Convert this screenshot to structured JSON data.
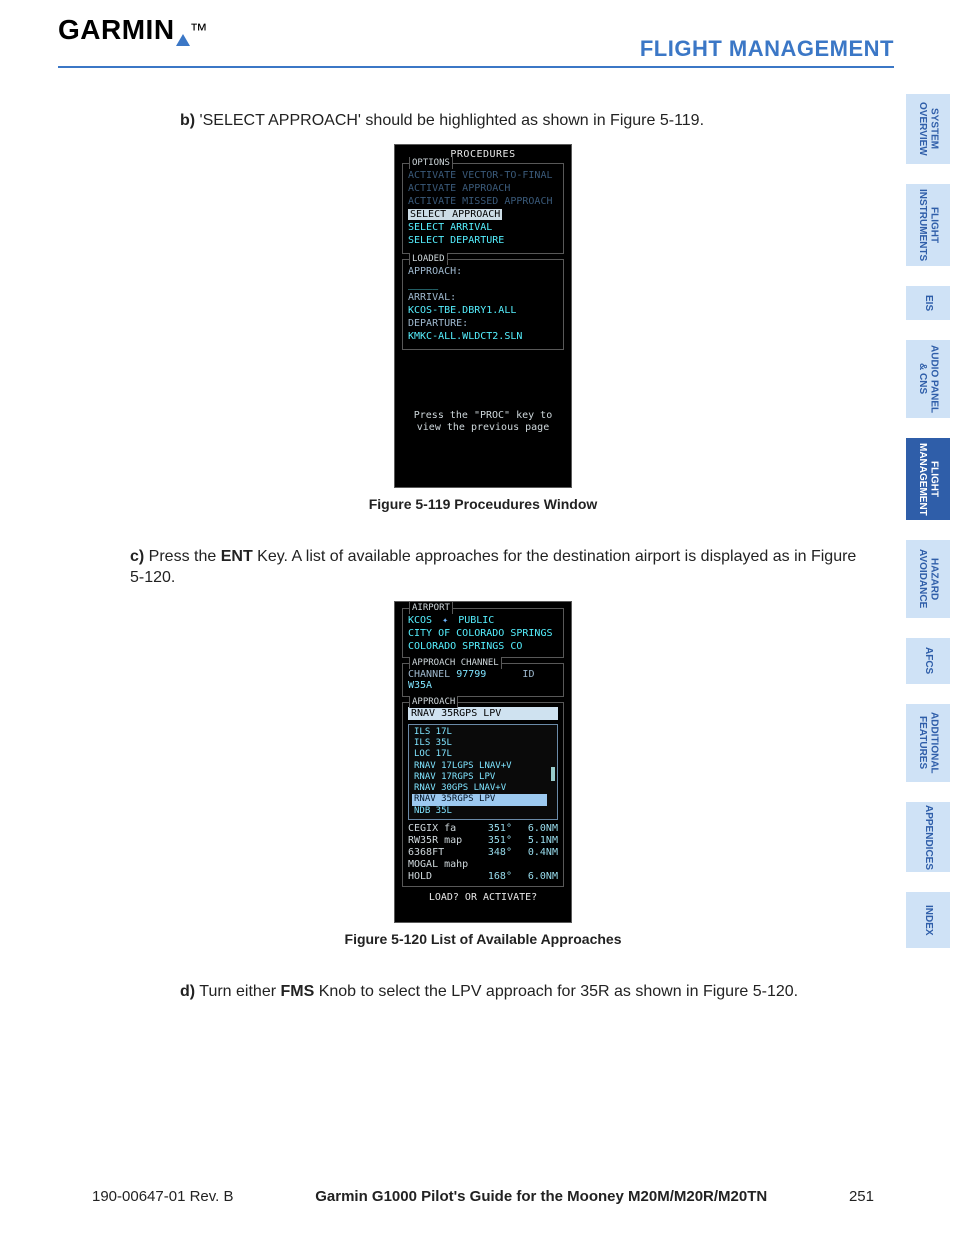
{
  "brand": "GARMIN",
  "header_section": "FLIGHT MANAGEMENT",
  "tabs": [
    "SYSTEM\nOVERVIEW",
    "FLIGHT\nINSTRUMENTS",
    "EIS",
    "AUDIO PANEL\n& CNS",
    "FLIGHT\nMANAGEMENT",
    "HAZARD\nAVOIDANCE",
    "AFCS",
    "ADDITIONAL\nFEATURES",
    "APPENDICES",
    "INDEX"
  ],
  "active_tab_index": 4,
  "para_b": {
    "label": "b)",
    "text": " 'SELECT APPROACH' should be highlighted as shown in Figure 5-119."
  },
  "fig119": {
    "title": "PROCEDURES",
    "options_tag": "OPTIONS",
    "opts": {
      "vtf": "ACTIVATE VECTOR-TO-FINAL",
      "act": "ACTIVATE APPROACH",
      "miss": "ACTIVATE MISSED APPROACH",
      "sel_appr": "SELECT APPROACH",
      "sel_arr": "SELECT ARRIVAL",
      "sel_dep": "SELECT DEPARTURE"
    },
    "loaded_tag": "LOADED",
    "appr_lbl": "APPROACH:",
    "appr_val": "_____",
    "arr_lbl": "ARRIVAL:",
    "arr_val": "KCOS-TBE.DBRY1.ALL",
    "dep_lbl": "DEPARTURE:",
    "dep_val": "KMKC-ALL.WLDCT2.SLN",
    "foot1": "Press the \"PROC\" key to",
    "foot2": "view the previous page",
    "caption": "Figure 5-119  Proceudures Window"
  },
  "para_c": {
    "label": "c)",
    "pre": " Press the ",
    "key": "ENT",
    "post": " Key.  A list of available approaches for the destination airport is displayed as in Figure 5-120."
  },
  "fig120": {
    "airport_tag": "AIRPORT",
    "apt_id": "KCOS",
    "apt_kind": "PUBLIC",
    "apt_name": "CITY OF COLORADO SPRINGS",
    "apt_city": "COLORADO SPRINGS CO",
    "chan_tag": "APPROACH CHANNEL",
    "chan_lbl": "CHANNEL",
    "chan_val": "97799",
    "chan_id_lbl": "ID",
    "chan_id_val": "W35A",
    "approach_tag": "APPROACH",
    "approach_sel": "RNAV 35RGPS LPV",
    "list": [
      "ILS 17L",
      "ILS 35L",
      "LOC 17L",
      "RNAV 17LGPS LNAV+V",
      "RNAV 17RGPS LPV",
      "RNAV 30GPS LNAV+V",
      "RNAV 35RGPS LPV",
      "NDB 35L"
    ],
    "list_hi_index": 6,
    "seq": [
      {
        "wpt": "CEGIX fa",
        "crs": "351°",
        "dist": "6.0NM"
      },
      {
        "wpt": "RW35R map",
        "crs": "351°",
        "dist": "5.1NM"
      },
      {
        "wpt": "6368FT",
        "crs": "348°",
        "dist": "0.4NM"
      },
      {
        "wpt": "MOGAL mahp",
        "crs": "",
        "dist": ""
      },
      {
        "wpt": "HOLD",
        "crs": "168°",
        "dist": "6.0NM"
      }
    ],
    "bottom": "LOAD? OR ACTIVATE?",
    "caption": "Figure 5-120  List of Available Approaches"
  },
  "para_d": {
    "label": "d)",
    "pre": " Turn either ",
    "key": "FMS",
    "post": " Knob to select the LPV approach for 35R as shown in Figure 5-120."
  },
  "footer": {
    "left": "190-00647-01  Rev. B",
    "center": "Garmin G1000 Pilot's Guide for the Mooney M20M/M20R/M20TN",
    "right": "251"
  }
}
